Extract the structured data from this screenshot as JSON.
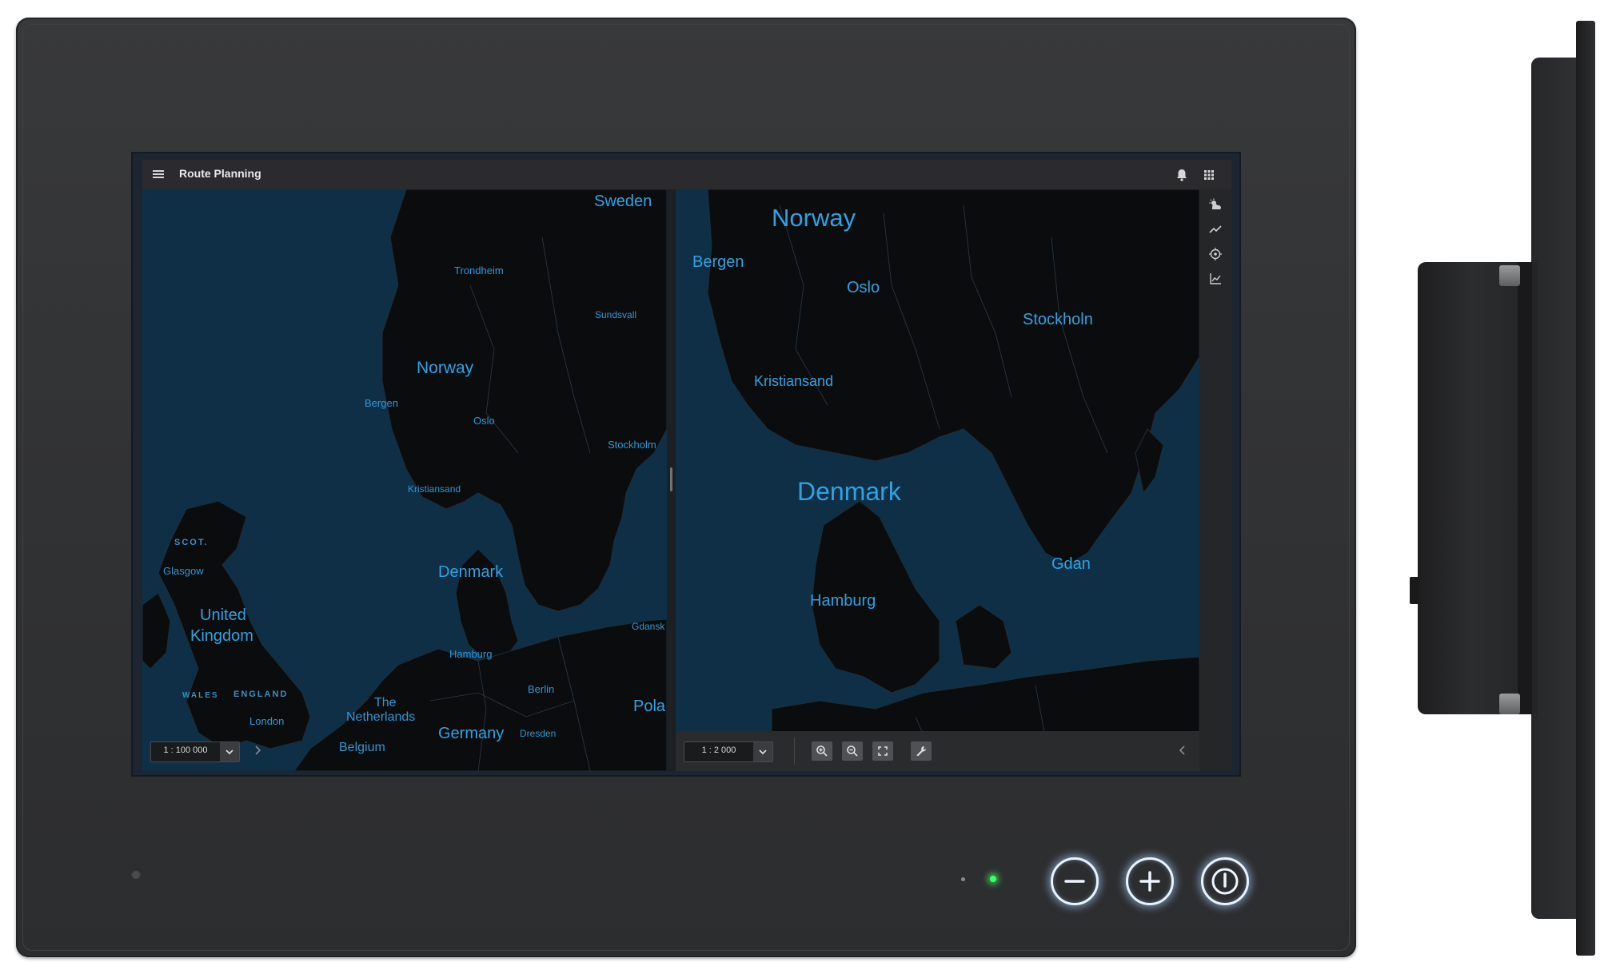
{
  "app": {
    "title": "Route Planning"
  },
  "header": {
    "icons": [
      "menu-icon",
      "bell-icon",
      "apps-grid-icon"
    ]
  },
  "left_map": {
    "scale": "1 : 100 000",
    "labels": {
      "sweden": "Sweden",
      "trondheim": "Trondheim",
      "sundsvall": "Sundsvall",
      "norway": "Norway",
      "bergen": "Bergen",
      "oslo": "Oslo",
      "stockholm": "Stockholm",
      "kristiansand": "Kristiansand",
      "scot": "SCOT.",
      "glasgow": "Glasgow",
      "denmark": "Denmark",
      "united": "United",
      "kingdom": "Kingdom",
      "gdansk": "Gdansk",
      "hamburg": "Hamburg",
      "berlin": "Berlin",
      "wales": "WALES",
      "england": "ENGLAND",
      "the": "The",
      "netherlands": "Netherlands",
      "pola": "Pola",
      "london": "London",
      "germany": "Germany",
      "dresden": "Dresden",
      "belgium": "Belgium"
    }
  },
  "right_map": {
    "scale": "1 : 2 000",
    "labels": {
      "norway": "Norway",
      "bergen": "Bergen",
      "oslo": "Oslo",
      "stockholm": "Stockholn",
      "kristiansand": "Kristiansand",
      "denmark": "Denmark",
      "gdansk": "Gdan",
      "hamburg": "Hamburg"
    },
    "toolbar_icons": [
      "zoom-in-icon",
      "zoom-out-icon",
      "fit-screen-icon",
      "wrench-icon"
    ]
  },
  "rail": {
    "icons": [
      "weather-icon",
      "trend-icon",
      "target-icon",
      "chart-icon"
    ]
  },
  "device": {
    "buttons": [
      "minus",
      "plus",
      "power"
    ]
  },
  "colors": {
    "water": "#0e2f46",
    "land": "#0c0c0e",
    "label": "#2ea3e4",
    "header": "#2b2b2d"
  }
}
